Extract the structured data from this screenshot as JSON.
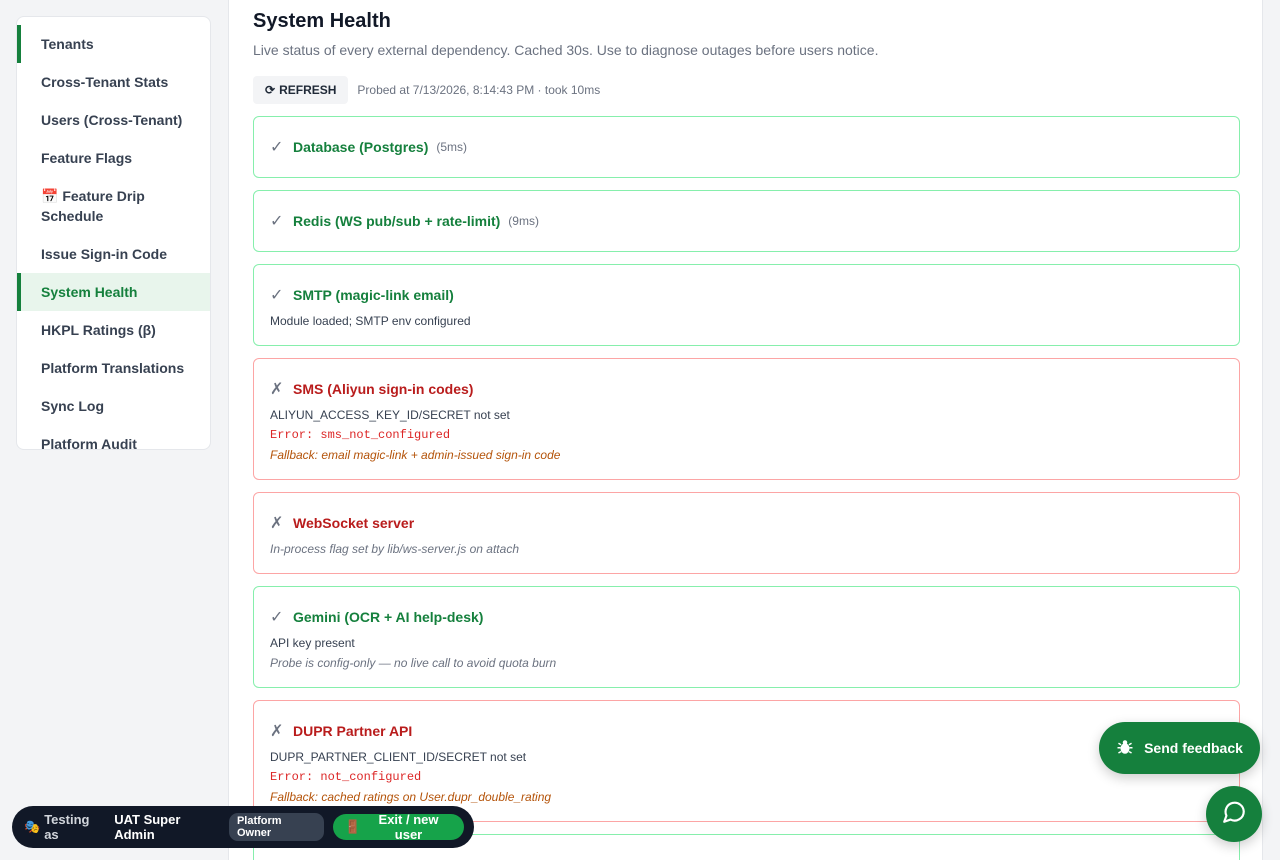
{
  "sidebar": {
    "items": [
      {
        "label": "Tenants"
      },
      {
        "label": "Cross-Tenant Stats"
      },
      {
        "label": "Users (Cross-Tenant)"
      },
      {
        "label": "Feature Flags"
      },
      {
        "label": "📅 Feature Drip Schedule"
      },
      {
        "label": "Issue Sign-in Code"
      },
      {
        "label": "System Health"
      },
      {
        "label": "HKPL Ratings (β)"
      },
      {
        "label": "Platform Translations"
      },
      {
        "label": "Sync Log"
      },
      {
        "label": "Platform Audit"
      }
    ],
    "active_index": 6
  },
  "page": {
    "title": "System Health",
    "subtitle": "Live status of every external dependency. Cached 30s. Use to diagnose outages before users notice.",
    "refresh_icon": "⟳",
    "refresh_label": "REFRESH",
    "probe_info": "Probed at 7/13/2026, 8:14:43 PM · took 10ms"
  },
  "checks": [
    {
      "ok": true,
      "icon": "✓",
      "name": "Database (Postgres)",
      "latency": "(5ms)"
    },
    {
      "ok": true,
      "icon": "✓",
      "name": "Redis (WS pub/sub + rate-limit)",
      "latency": "(9ms)"
    },
    {
      "ok": true,
      "icon": "✓",
      "name": "SMTP (magic-link email)",
      "detail": "Module loaded; SMTP env configured"
    },
    {
      "ok": false,
      "icon": "✗",
      "name": "SMS (Aliyun sign-in codes)",
      "detail": "ALIYUN_ACCESS_KEY_ID/SECRET not set",
      "error": "Error: sms_not_configured",
      "fallback": "Fallback: email magic-link + admin-issued sign-in code"
    },
    {
      "ok": false,
      "icon": "✗",
      "name": "WebSocket server",
      "note": "In-process flag set by lib/ws-server.js on attach"
    },
    {
      "ok": true,
      "icon": "✓",
      "name": "Gemini (OCR + AI help-desk)",
      "detail": "API key present",
      "note": "Probe is config-only — no live call to avoid quota burn"
    },
    {
      "ok": false,
      "icon": "✗",
      "name": "DUPR Partner API",
      "detail": "DUPR_PARTNER_CLIENT_ID/SECRET not set",
      "error": "Error: not_configured",
      "fallback": "Fallback: cached ratings on User.dupr_double_rating"
    }
  ],
  "feedback": {
    "label": "Send feedback",
    "icon": "bug-icon"
  },
  "chat": {
    "icon": "chat-bubble-icon"
  },
  "testing": {
    "emoji": "🎭",
    "label": "Testing as",
    "user": "UAT Super Admin",
    "role": "Platform Owner",
    "exit_icon": "🚪",
    "exit_label": "Exit / new user"
  },
  "colors": {
    "accent": "#15803d",
    "ok_border": "#86efac",
    "fail_border": "#fca5a5",
    "error_text": "#dc2626",
    "fallback_text": "#b45309"
  }
}
